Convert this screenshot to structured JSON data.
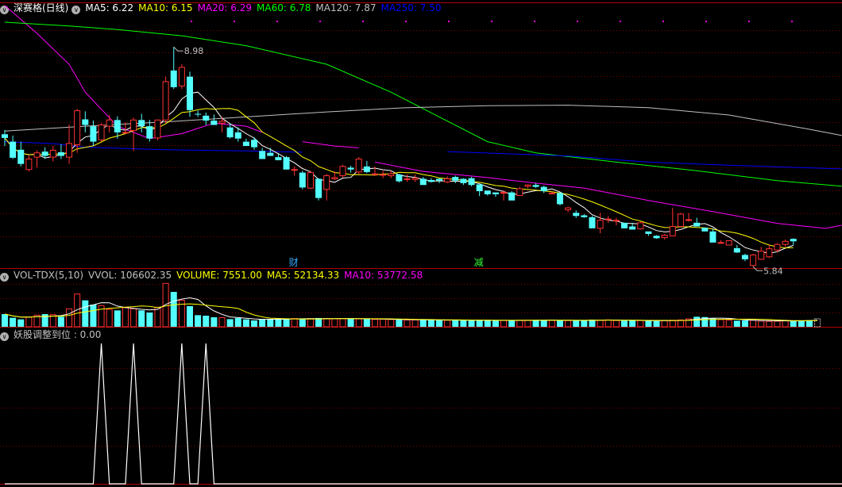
{
  "main_panel": {
    "title": "深赛格(日线)",
    "ma_legend": [
      {
        "label": "MA5: 6.22",
        "color": "#ffffff"
      },
      {
        "label": "MA10: 6.15",
        "color": "#ffff00"
      },
      {
        "label": "MA20: 6.29",
        "color": "#ff00ff"
      },
      {
        "label": "MA60: 6.78",
        "color": "#00ff00"
      },
      {
        "label": "MA120: 7.87",
        "color": "#c0c0c0"
      },
      {
        "label": "MA250: 7.50",
        "color": "#0000ff"
      }
    ],
    "high_label": "8.98",
    "low_label": "5.84",
    "markers": [
      {
        "text": "财",
        "color": "#33aaff"
      },
      {
        "text": "减",
        "color": "#33ff33"
      }
    ]
  },
  "volume_panel": {
    "legend": [
      {
        "label": "VOL-TDX(5,10)",
        "color": "#c0c0c0"
      },
      {
        "label": "VVOL: 106602.35",
        "color": "#c0c0c0"
      },
      {
        "label": "VOLUME: 7551.00",
        "color": "#ffff00"
      },
      {
        "label": "MA5: 52134.33",
        "color": "#ffff00"
      },
      {
        "label": "MA10: 53772.58",
        "color": "#ff00ff"
      }
    ]
  },
  "indicator_panel": {
    "legend": [
      {
        "label": "妖股调整到位 : 0.00",
        "color": "#c0c0c0"
      }
    ]
  },
  "colors": {
    "up": "#ff3232",
    "down": "#54ffff",
    "grid": "#800000",
    "border": "#b00000"
  },
  "chart_data": {
    "type": "candlestick",
    "title": "深赛格(日线)",
    "ylim": [
      5.6,
      9.7
    ],
    "max_price": 8.98,
    "min_price": 5.84,
    "candles": [
      {
        "o": 7.57,
        "h": 7.64,
        "l": 7.38,
        "c": 7.51
      },
      {
        "o": 7.45,
        "h": 7.55,
        "l": 7.17,
        "c": 7.19
      },
      {
        "o": 7.32,
        "h": 7.45,
        "l": 7.05,
        "c": 7.09
      },
      {
        "o": 7.0,
        "h": 7.24,
        "l": 6.97,
        "c": 7.17
      },
      {
        "o": 7.2,
        "h": 7.31,
        "l": 7.03,
        "c": 7.27
      },
      {
        "o": 7.29,
        "h": 7.36,
        "l": 7.17,
        "c": 7.22
      },
      {
        "o": 7.2,
        "h": 7.38,
        "l": 7.13,
        "c": 7.31
      },
      {
        "o": 7.28,
        "h": 7.41,
        "l": 7.17,
        "c": 7.22
      },
      {
        "o": 7.2,
        "h": 7.73,
        "l": 7.09,
        "c": 7.42
      },
      {
        "o": 7.4,
        "h": 7.98,
        "l": 7.27,
        "c": 7.95
      },
      {
        "o": 7.81,
        "h": 7.94,
        "l": 7.6,
        "c": 7.72
      },
      {
        "o": 7.7,
        "h": 7.79,
        "l": 7.38,
        "c": 7.45
      },
      {
        "o": 7.48,
        "h": 7.75,
        "l": 7.45,
        "c": 7.72
      },
      {
        "o": 7.7,
        "h": 7.88,
        "l": 7.6,
        "c": 7.8
      },
      {
        "o": 7.8,
        "h": 7.86,
        "l": 7.5,
        "c": 7.6
      },
      {
        "o": 7.6,
        "h": 7.76,
        "l": 7.58,
        "c": 7.6
      },
      {
        "o": 7.63,
        "h": 7.84,
        "l": 7.3,
        "c": 7.8
      },
      {
        "o": 7.8,
        "h": 7.9,
        "l": 7.6,
        "c": 7.7
      },
      {
        "o": 7.7,
        "h": 7.8,
        "l": 7.45,
        "c": 7.5
      },
      {
        "o": 7.51,
        "h": 7.8,
        "l": 7.47,
        "c": 7.8
      },
      {
        "o": 7.8,
        "h": 8.5,
        "l": 7.75,
        "c": 8.42
      },
      {
        "o": 8.6,
        "h": 8.98,
        "l": 8.3,
        "c": 8.33
      },
      {
        "o": 8.35,
        "h": 8.7,
        "l": 8.3,
        "c": 8.65
      },
      {
        "o": 8.5,
        "h": 8.58,
        "l": 7.85,
        "c": 7.96
      },
      {
        "o": 7.9,
        "h": 7.95,
        "l": 7.85,
        "c": 7.89
      },
      {
        "o": 7.87,
        "h": 7.92,
        "l": 7.72,
        "c": 7.79
      },
      {
        "o": 7.79,
        "h": 7.89,
        "l": 7.72,
        "c": 7.72
      },
      {
        "o": 7.75,
        "h": 7.85,
        "l": 7.6,
        "c": 7.78
      },
      {
        "o": 7.68,
        "h": 7.75,
        "l": 7.5,
        "c": 7.52
      },
      {
        "o": 7.6,
        "h": 7.68,
        "l": 7.45,
        "c": 7.5
      },
      {
        "o": 7.45,
        "h": 7.5,
        "l": 7.38,
        "c": 7.38
      },
      {
        "o": 7.48,
        "h": 7.52,
        "l": 7.32,
        "c": 7.36
      },
      {
        "o": 7.3,
        "h": 7.35,
        "l": 7.17,
        "c": 7.17
      },
      {
        "o": 7.27,
        "h": 7.35,
        "l": 7.22,
        "c": 7.22
      },
      {
        "o": 7.2,
        "h": 7.25,
        "l": 7.15,
        "c": 7.15
      },
      {
        "o": 7.2,
        "h": 7.22,
        "l": 7.0,
        "c": 7.0
      },
      {
        "o": 7.0,
        "h": 7.05,
        "l": 6.9,
        "c": 7.0
      },
      {
        "o": 6.95,
        "h": 6.98,
        "l": 6.68,
        "c": 6.71
      },
      {
        "o": 6.7,
        "h": 6.98,
        "l": 6.68,
        "c": 6.95
      },
      {
        "o": 6.85,
        "h": 6.86,
        "l": 6.5,
        "c": 6.54
      },
      {
        "o": 6.68,
        "h": 6.93,
        "l": 6.5,
        "c": 6.9
      },
      {
        "o": 6.85,
        "h": 6.97,
        "l": 6.83,
        "c": 6.87
      },
      {
        "o": 6.9,
        "h": 7.08,
        "l": 6.87,
        "c": 7.05
      },
      {
        "o": 7.03,
        "h": 7.06,
        "l": 6.95,
        "c": 7.0
      },
      {
        "o": 6.96,
        "h": 7.2,
        "l": 6.92,
        "c": 7.17
      },
      {
        "o": 7.05,
        "h": 7.14,
        "l": 6.94,
        "c": 6.96
      },
      {
        "o": 6.93,
        "h": 7.05,
        "l": 6.9,
        "c": 6.93
      },
      {
        "o": 6.92,
        "h": 6.98,
        "l": 6.86,
        "c": 6.92
      },
      {
        "o": 6.9,
        "h": 6.98,
        "l": 6.86,
        "c": 6.93
      },
      {
        "o": 6.92,
        "h": 6.93,
        "l": 6.79,
        "c": 6.81
      },
      {
        "o": 6.85,
        "h": 6.92,
        "l": 6.8,
        "c": 6.85
      },
      {
        "o": 6.84,
        "h": 6.92,
        "l": 6.8,
        "c": 6.86
      },
      {
        "o": 6.85,
        "h": 6.88,
        "l": 6.75,
        "c": 6.75
      },
      {
        "o": 6.83,
        "h": 6.86,
        "l": 6.79,
        "c": 6.8
      },
      {
        "o": 6.85,
        "h": 6.86,
        "l": 6.78,
        "c": 6.82
      },
      {
        "o": 6.8,
        "h": 6.89,
        "l": 6.78,
        "c": 6.85
      },
      {
        "o": 6.88,
        "h": 6.9,
        "l": 6.78,
        "c": 6.82
      },
      {
        "o": 6.85,
        "h": 6.86,
        "l": 6.75,
        "c": 6.78
      },
      {
        "o": 6.86,
        "h": 6.88,
        "l": 6.73,
        "c": 6.75
      },
      {
        "o": 6.76,
        "h": 6.76,
        "l": 6.57,
        "c": 6.65
      },
      {
        "o": 6.66,
        "h": 6.66,
        "l": 6.58,
        "c": 6.6
      },
      {
        "o": 6.63,
        "h": 6.63,
        "l": 6.56,
        "c": 6.6
      },
      {
        "o": 6.63,
        "h": 6.66,
        "l": 6.5,
        "c": 6.63
      },
      {
        "o": 6.63,
        "h": 6.65,
        "l": 6.5,
        "c": 6.5
      },
      {
        "o": 6.58,
        "h": 6.72,
        "l": 6.58,
        "c": 6.69
      },
      {
        "o": 6.73,
        "h": 6.76,
        "l": 6.7,
        "c": 6.75
      },
      {
        "o": 6.75,
        "h": 6.78,
        "l": 6.7,
        "c": 6.72
      },
      {
        "o": 6.72,
        "h": 6.74,
        "l": 6.62,
        "c": 6.65
      },
      {
        "o": 6.62,
        "h": 6.64,
        "l": 6.6,
        "c": 6.62
      },
      {
        "o": 6.62,
        "h": 6.63,
        "l": 6.42,
        "c": 6.44
      },
      {
        "o": 6.35,
        "h": 6.4,
        "l": 6.31,
        "c": 6.38
      },
      {
        "o": 6.3,
        "h": 6.34,
        "l": 6.22,
        "c": 6.25
      },
      {
        "o": 6.26,
        "h": 6.28,
        "l": 6.22,
        "c": 6.23
      },
      {
        "o": 6.23,
        "h": 6.25,
        "l": 6.05,
        "c": 6.05
      },
      {
        "o": 6.05,
        "h": 6.3,
        "l": 5.97,
        "c": 6.18
      },
      {
        "o": 6.2,
        "h": 6.25,
        "l": 6.14,
        "c": 6.2
      },
      {
        "o": 6.18,
        "h": 6.22,
        "l": 6.1,
        "c": 6.18
      },
      {
        "o": 6.14,
        "h": 6.14,
        "l": 6.05,
        "c": 6.05
      },
      {
        "o": 6.08,
        "h": 6.14,
        "l": 6.03,
        "c": 6.03
      },
      {
        "o": 6.04,
        "h": 6.16,
        "l": 6.03,
        "c": 6.14
      },
      {
        "o": 6.0,
        "h": 6.0,
        "l": 5.93,
        "c": 5.96
      },
      {
        "o": 5.93,
        "h": 5.94,
        "l": 5.88,
        "c": 5.89
      },
      {
        "o": 5.9,
        "h": 5.96,
        "l": 5.87,
        "c": 5.94
      },
      {
        "o": 5.93,
        "h": 6.38,
        "l": 5.93,
        "c": 6.08
      },
      {
        "o": 6.08,
        "h": 6.3,
        "l": 6.08,
        "c": 6.28
      },
      {
        "o": 6.18,
        "h": 6.3,
        "l": 6.16,
        "c": 6.19
      },
      {
        "o": 6.14,
        "h": 6.22,
        "l": 6.08,
        "c": 6.08
      },
      {
        "o": 6.06,
        "h": 6.06,
        "l": 6.0,
        "c": 6.0
      },
      {
        "o": 6.0,
        "h": 6.05,
        "l": 5.82,
        "c": 5.82
      },
      {
        "o": 5.82,
        "h": 5.86,
        "l": 5.8,
        "c": 5.82
      },
      {
        "o": 5.78,
        "h": 5.85,
        "l": 5.78,
        "c": 5.85
      },
      {
        "o": 5.73,
        "h": 5.78,
        "l": 5.65,
        "c": 5.66
      },
      {
        "o": 5.62,
        "h": 5.64,
        "l": 5.52,
        "c": 5.55
      },
      {
        "o": 5.45,
        "h": 5.64,
        "l": 5.43,
        "c": 5.62
      },
      {
        "o": 5.55,
        "h": 5.75,
        "l": 5.54,
        "c": 5.68
      },
      {
        "o": 5.59,
        "h": 5.79,
        "l": 5.57,
        "c": 5.72
      },
      {
        "o": 5.7,
        "h": 5.81,
        "l": 5.66,
        "c": 5.79
      },
      {
        "o": 5.79,
        "h": 5.87,
        "l": 5.75,
        "c": 5.84
      },
      {
        "o": 5.88,
        "h": 5.89,
        "l": 5.78,
        "c": 5.84
      }
    ],
    "ma_series": [
      {
        "name": "MA20",
        "color": "#ff00ff",
        "points": [
          [
            0,
            9.65
          ],
          [
            4,
            9.2
          ],
          [
            8,
            8.7
          ],
          [
            10,
            8.25
          ],
          [
            14,
            7.7
          ],
          [
            18,
            7.5
          ],
          [
            22,
            7.58
          ],
          [
            26,
            7.75
          ],
          [
            30,
            7.7
          ],
          [
            32,
            7.6
          ]
        ]
      },
      {
        "name": "MA20",
        "color": "#ff00ff",
        "points": [
          [
            37,
            7.45
          ],
          [
            41,
            7.38
          ],
          [
            44,
            7.35
          ]
        ]
      },
      {
        "name": "MA20",
        "color": "#ff00ff",
        "points": [
          [
            46,
            7.12
          ],
          [
            52,
            6.97
          ],
          [
            60,
            6.87
          ],
          [
            66,
            6.78
          ],
          [
            72,
            6.7
          ],
          [
            80,
            6.5
          ],
          [
            88,
            6.32
          ],
          [
            96,
            6.13
          ],
          [
            102,
            6.05
          ],
          [
            104,
            6.1
          ]
        ]
      },
      {
        "name": "MA60",
        "color": "#00ff00",
        "points": [
          [
            0,
            9.38
          ],
          [
            8,
            9.32
          ],
          [
            14,
            9.26
          ],
          [
            22,
            9.16
          ],
          [
            30,
            9.0
          ],
          [
            40,
            8.7
          ],
          [
            48,
            8.25
          ],
          [
            54,
            7.85
          ],
          [
            60,
            7.45
          ],
          [
            66,
            7.27
          ],
          [
            76,
            7.12
          ],
          [
            86,
            6.98
          ],
          [
            96,
            6.82
          ],
          [
            104,
            6.73
          ]
        ]
      },
      {
        "name": "MA120",
        "color": "#c0c0c0",
        "points": [
          [
            0,
            7.62
          ],
          [
            10,
            7.7
          ],
          [
            20,
            7.77
          ],
          [
            30,
            7.85
          ],
          [
            40,
            7.93
          ],
          [
            50,
            8.0
          ],
          [
            60,
            8.03
          ],
          [
            70,
            8.04
          ],
          [
            80,
            8.0
          ],
          [
            90,
            7.88
          ],
          [
            100,
            7.65
          ],
          [
            104,
            7.55
          ]
        ]
      },
      {
        "name": "MA250",
        "color": "#0000ff",
        "points": [
          [
            0,
            7.45
          ],
          [
            6,
            7.42
          ],
          [
            10,
            7.36
          ],
          [
            20,
            7.32
          ],
          [
            30,
            7.3
          ],
          [
            37,
            7.28
          ]
        ]
      },
      {
        "name": "MA250",
        "color": "#0000ff",
        "points": [
          [
            55,
            7.29
          ],
          [
            70,
            7.22
          ],
          [
            80,
            7.12
          ],
          [
            90,
            7.07
          ],
          [
            104,
            7.01
          ]
        ]
      }
    ],
    "volume": [
      12000,
      8500,
      7000,
      9000,
      11000,
      12000,
      11500,
      9500,
      17000,
      31000,
      25000,
      21000,
      20000,
      16500,
      15500,
      18000,
      17000,
      15500,
      13500,
      18500,
      41000,
      33000,
      25000,
      19500,
      11000,
      10500,
      9000,
      8700,
      7200,
      8200,
      7000,
      6000,
      7000,
      7500,
      7800,
      7400,
      7800,
      7400,
      7700,
      8300,
      7800,
      7600,
      7700,
      7700,
      7500,
      7200,
      7000,
      7200,
      6900,
      6600,
      6400,
      6500,
      6600,
      6400,
      6300,
      6200,
      6300,
      6300,
      6200,
      6200,
      6000,
      5800,
      6000,
      6100,
      6200,
      6200,
      6500,
      6500,
      6300,
      5800,
      5900,
      5700,
      6400,
      6800,
      6300,
      6500,
      6000,
      5800,
      6000,
      5900,
      5700,
      5500,
      5900,
      6200,
      6500,
      7500,
      9500,
      9200,
      8000,
      6800,
      6200,
      5800,
      6000,
      6200,
      5500,
      5200,
      5300,
      5800,
      6000,
      5800,
      6200,
      7551
    ],
    "indicator": {
      "type": "line",
      "spikes_at": [
        12,
        16,
        22,
        25
      ]
    }
  }
}
